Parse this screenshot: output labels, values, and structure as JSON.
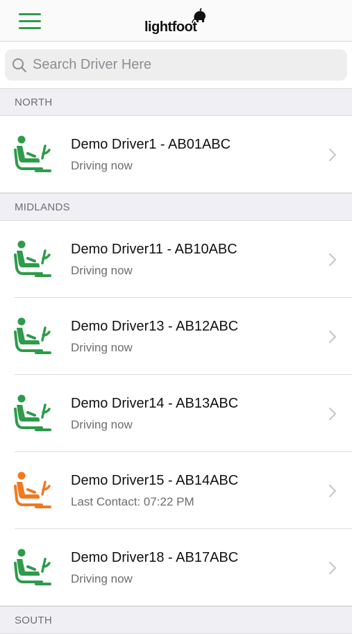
{
  "header": {
    "logo_text": "lightfoot"
  },
  "search": {
    "placeholder": "Search Driver Here"
  },
  "colors": {
    "accent": "#2e9b4a",
    "driving": "#2e9b4a",
    "last_contact": "#f07a20"
  },
  "sections": [
    {
      "name": "NORTH",
      "drivers": [
        {
          "title": "Demo Driver1 - AB01ABC",
          "status": "Driving now",
          "state": "driving"
        }
      ]
    },
    {
      "name": "MIDLANDS",
      "drivers": [
        {
          "title": "Demo Driver11 - AB10ABC",
          "status": "Driving now",
          "state": "driving"
        },
        {
          "title": "Demo Driver13 - AB12ABC",
          "status": "Driving now",
          "state": "driving"
        },
        {
          "title": "Demo Driver14 - AB13ABC",
          "status": "Driving now",
          "state": "driving"
        },
        {
          "title": "Demo Driver15 - AB14ABC",
          "status": "Last Contact: 07:22 PM",
          "state": "last_contact"
        },
        {
          "title": "Demo Driver18 - AB17ABC",
          "status": "Driving now",
          "state": "driving"
        }
      ]
    },
    {
      "name": "SOUTH",
      "drivers": []
    }
  ]
}
